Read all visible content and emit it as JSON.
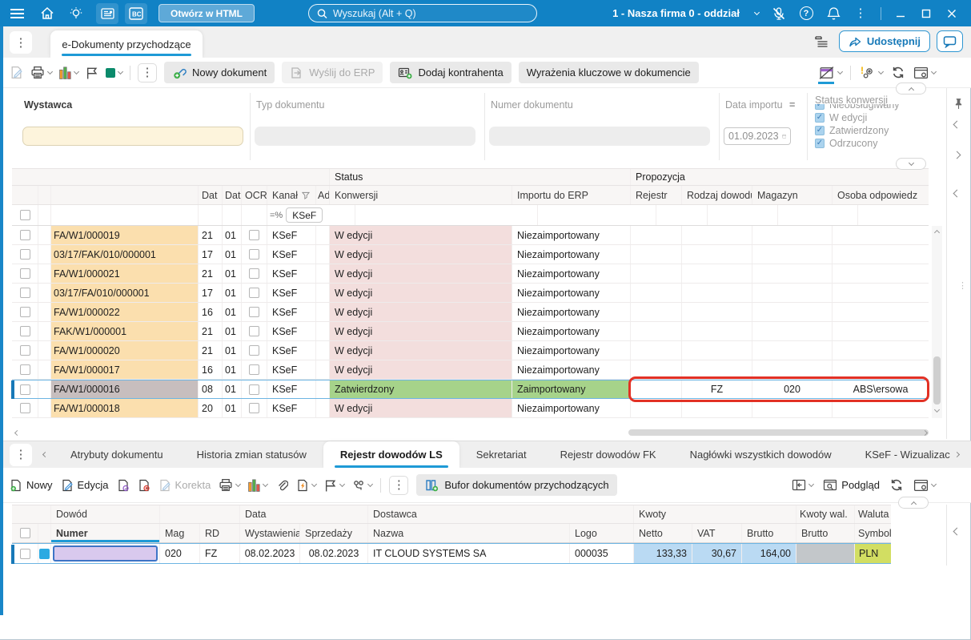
{
  "titlebar": {
    "open_html": "Otwórz w HTML",
    "search_placeholder": "Wyszukaj (Alt + Q)",
    "company": "1 - Nasza firma 0 - oddział"
  },
  "tabbar": {
    "document_tab": "e-Dokumenty przychodzące",
    "share": "Udostępnij"
  },
  "toolbar": {
    "new_document": "Nowy dokument",
    "send_to_erp": "Wyślij do ERP",
    "add_contractor": "Dodaj kontrahenta",
    "key_expressions": "Wyrażenia kluczowe w dokumencie"
  },
  "filters": {
    "wystawca": "Wystawca",
    "typ_dokumentu": "Typ dokumentu",
    "numer_dokumentu": "Numer dokumentu",
    "data_importu": "Data importu",
    "data_importu_operator": "=",
    "data_importu_value": "01.09.2023",
    "status_konwersji": "Status konwersji",
    "status_options": [
      "Nieobsługiwany",
      "W edycji",
      "Zatwierdzony",
      "Odrzucony"
    ]
  },
  "grid": {
    "groups": {
      "status": "Status",
      "propozycja": "Propozycja"
    },
    "columns": {
      "dat1": "Dat",
      "dat2": "Dat",
      "ocr": "OCR",
      "kanal": "Kanał",
      "ad": "Ad",
      "konwersji": "Konwersji",
      "import_erp": "Importu do ERP",
      "rejestr": "Rejestr",
      "rodzaj": "Rodzaj dowodu",
      "magazyn": "Magazyn",
      "osoba": "Osoba odpowiedz"
    },
    "filter_operator": "=%",
    "filter_value": "KSeF",
    "rows": [
      {
        "numer": "FA/W1/000019",
        "d1": "21",
        "d2": "01",
        "kanal": "KSeF",
        "konwersji": "W edycji",
        "import": "Niezaimportowany",
        "rejestr": "",
        "rodzaj": "",
        "magazyn": "",
        "osoba": ""
      },
      {
        "numer": "03/17/FAK/010/000001",
        "d1": "17",
        "d2": "01",
        "kanal": "KSeF",
        "konwersji": "W edycji",
        "import": "Niezaimportowany",
        "rejestr": "",
        "rodzaj": "",
        "magazyn": "",
        "osoba": ""
      },
      {
        "numer": "FA/W1/000021",
        "d1": "21",
        "d2": "01",
        "kanal": "KSeF",
        "konwersji": "W edycji",
        "import": "Niezaimportowany",
        "rejestr": "",
        "rodzaj": "",
        "magazyn": "",
        "osoba": ""
      },
      {
        "numer": "03/17/FA/010/000001",
        "d1": "17",
        "d2": "01",
        "kanal": "KSeF",
        "konwersji": "W edycji",
        "import": "Niezaimportowany",
        "rejestr": "",
        "rodzaj": "",
        "magazyn": "",
        "osoba": ""
      },
      {
        "numer": "FA/W1/000022",
        "d1": "16",
        "d2": "01",
        "kanal": "KSeF",
        "konwersji": "W edycji",
        "import": "Niezaimportowany",
        "rejestr": "",
        "rodzaj": "",
        "magazyn": "",
        "osoba": ""
      },
      {
        "numer": "FAK/W1/000001",
        "d1": "21",
        "d2": "01",
        "kanal": "KSeF",
        "konwersji": "W edycji",
        "import": "Niezaimportowany",
        "rejestr": "",
        "rodzaj": "",
        "magazyn": "",
        "osoba": ""
      },
      {
        "numer": "FA/W1/000020",
        "d1": "21",
        "d2": "01",
        "kanal": "KSeF",
        "konwersji": "W edycji",
        "import": "Niezaimportowany",
        "rejestr": "",
        "rodzaj": "",
        "magazyn": "",
        "osoba": ""
      },
      {
        "numer": "FA/W1/000017",
        "d1": "16",
        "d2": "01",
        "kanal": "KSeF",
        "konwersji": "W edycji",
        "import": "Niezaimportowany",
        "rejestr": "",
        "rodzaj": "",
        "magazyn": "",
        "osoba": ""
      },
      {
        "numer": "FA/W1/000016",
        "d1": "08",
        "d2": "01",
        "kanal": "KSeF",
        "konwersji": "Zatwierdzony",
        "import": "Zaimportowany",
        "rejestr": "",
        "rodzaj": "FZ",
        "magazyn": "020",
        "osoba": "ABS\\ersowa"
      },
      {
        "numer": "FA/W1/000018",
        "d1": "20",
        "d2": "01",
        "kanal": "KSeF",
        "konwersji": "W edycji",
        "import": "Niezaimportowany",
        "rejestr": "",
        "rodzaj": "",
        "magazyn": "",
        "osoba": ""
      }
    ]
  },
  "bottom_tabs": {
    "items": [
      "Atrybuty dokumentu",
      "Historia zmian statusów",
      "Rejestr dowodów LS",
      "Sekretariat",
      "Rejestr dowodów FK",
      "Nagłówki wszystkich dowodów",
      "KSeF - Wizualizac"
    ],
    "active": "Rejestr dowodów LS"
  },
  "bottom_toolbar": {
    "nowy": "Nowy",
    "edycja": "Edycja",
    "korekta": "Korekta",
    "bufor": "Bufor dokumentów przychodzących",
    "podglad": "Podgląd"
  },
  "detail": {
    "groups": {
      "dowod": "Dowód",
      "data": "Data",
      "dostawca": "Dostawca",
      "kwoty": "Kwoty",
      "kwoty_wal": "Kwoty wal.",
      "waluta": "Waluta"
    },
    "columns": {
      "numer": "Numer",
      "mag": "Mag",
      "rd": "RD",
      "wystawienia": "Wystawienia",
      "sprzedazy": "Sprzedaży",
      "nazwa": "Nazwa",
      "logo": "Logo",
      "netto": "Netto",
      "vat": "VAT",
      "brutto": "Brutto",
      "brutto_wal": "Brutto",
      "symbol": "Symbol"
    },
    "row": {
      "numer": "",
      "mag": "020",
      "rd": "FZ",
      "wystawienia": "08.02.2023",
      "sprzedazy": "08.02.2023",
      "nazwa": "IT CLOUD SYSTEMS SA",
      "logo": "000035",
      "netto": "133,33",
      "vat": "30,67",
      "brutto": "164,00",
      "brutto_wal": "",
      "symbol": "PLN"
    }
  },
  "colors": {
    "accent": "#1E9AD6",
    "titlebar": "#1182C5",
    "annotation": "#E23125",
    "numer_col_bg": "#FBDFAE",
    "status_w_edycji_bg": "#F3DEDD",
    "status_zatwierdzony_bg": "#A6D38A",
    "selected_numer_bg": "#C7BEBE",
    "amount_bg": "#BADAF3",
    "currency_bg": "#D2DE62",
    "filter_input_bg": "#FDF4DC"
  }
}
